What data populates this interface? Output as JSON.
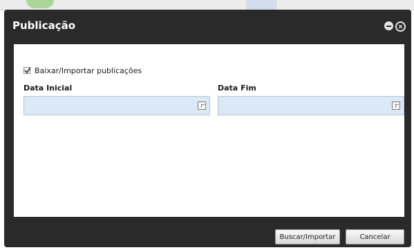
{
  "dialog": {
    "title": "Publicação",
    "checkbox": {
      "label": "Baixar/Importar publicações",
      "checked": true
    },
    "fields": {
      "start": {
        "label": "Data Inicial",
        "value": ""
      },
      "end": {
        "label": "Data Fim",
        "value": ""
      }
    },
    "buttons": {
      "search_import": "Buscar/Importar",
      "cancel": "Cancelar"
    }
  },
  "icons": {
    "minimize": "minimize-icon",
    "close": "close-icon",
    "calendar": "calendar-icon",
    "check": "check-icon"
  },
  "colors": {
    "titlebar": "#2a2a2a",
    "input_background": "#dbe8f5",
    "content_background": "#ffffff"
  }
}
